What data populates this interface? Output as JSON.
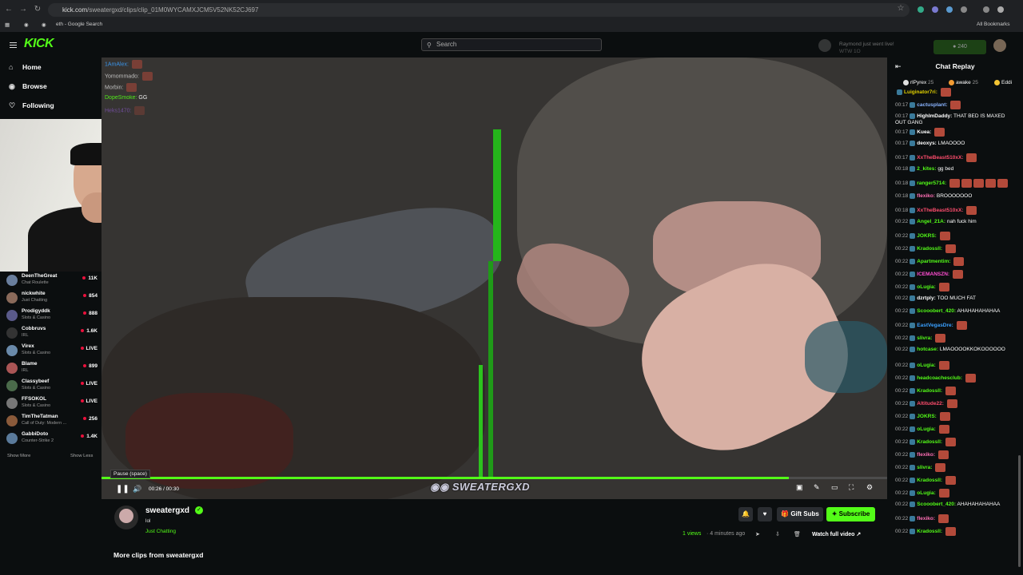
{
  "browser": {
    "url_host": "kick.com",
    "url_path": "/sweatergxd/clips/clip_01M0WYCAMXJCM5V52NK52CJ697",
    "bookmarks": [
      "eth - Google Search"
    ],
    "all_bookmarks": "All Bookmarks"
  },
  "header": {
    "logo": "KICK",
    "search_placeholder": "Search",
    "notification_title": "Raymond just went live!",
    "notification_sub": "WTW 1O",
    "coins": "240"
  },
  "sidebar": {
    "nav": [
      {
        "label": "Home",
        "icon": "home-icon"
      },
      {
        "label": "Browse",
        "icon": "browse-icon"
      },
      {
        "label": "Following",
        "icon": "heart-icon"
      }
    ],
    "channels": [
      {
        "name": "DeenTheGreat",
        "category": "Chat Roulette",
        "viewers": "11K",
        "color": "#6a7f9e"
      },
      {
        "name": "nickwhite",
        "category": "Just Chatting",
        "viewers": "854",
        "color": "#8a6a5a"
      },
      {
        "name": "Prodigyddk",
        "category": "Slots & Casino",
        "viewers": "888",
        "color": "#5a5a8a"
      },
      {
        "name": "Cobbruvs",
        "category": "IRL",
        "viewers": "1.6K",
        "color": "#333333"
      },
      {
        "name": "Virex",
        "category": "Slots & Casino",
        "viewers": "LIVE",
        "color": "#6a8aaa"
      },
      {
        "name": "Blame",
        "category": "IRL",
        "viewers": "899",
        "color": "#aa5555"
      },
      {
        "name": "Classybeef",
        "category": "Slots & Casino",
        "viewers": "LIVE",
        "color": "#4a6a4a"
      },
      {
        "name": "FFSOKOL",
        "category": "Slots & Casino",
        "viewers": "LIVE",
        "color": "#777777"
      },
      {
        "name": "TimTheTatman",
        "category": "Call of Duty: Modern ...",
        "viewers": "256",
        "color": "#8a5a3a"
      },
      {
        "name": "GabbiDoto",
        "category": "Counter-Strike 2",
        "viewers": "1.4K",
        "color": "#5a7a9a"
      }
    ],
    "show_more": "Show More",
    "show_less": "Show Less"
  },
  "stream_chat_overlay": [
    {
      "user": "1AmAlex:",
      "text": "",
      "color": "#3aa0ff"
    },
    {
      "user": "Yomommado:",
      "text": "",
      "color": "#cccccc"
    },
    {
      "user": "Morbin:",
      "text": "",
      "color": "#cccccc"
    },
    {
      "user": "DopeSmoke:",
      "text": "GG",
      "color": "#53fc18"
    },
    {
      "user": "Heks1470:",
      "text": "",
      "color": "#aa66ff"
    }
  ],
  "player": {
    "tooltip": "Pause (space)",
    "time": "00:26 / 00:30",
    "progress": 0.875,
    "watermark": "SWEATERGXD"
  },
  "clip": {
    "channel": "sweatergxd",
    "title": "lol",
    "category": "Just Chatting",
    "views": "1 views",
    "age": "4 minutes ago",
    "gift_subs": "Gift Subs",
    "subscribe": "Subscribe",
    "watch_full": "Watch full video",
    "more_clips": "More clips from sweatergxd"
  },
  "chat": {
    "title": "Chat Replay",
    "pinned": [
      {
        "name": "rlPyrex",
        "count": "25"
      },
      {
        "name": "awake",
        "count": "25"
      },
      {
        "name": "Eddi",
        "count": ""
      }
    ],
    "messages": [
      {
        "t": "",
        "u": "Luiginator7ri:",
        "c": "#e0d000",
        "m": "",
        "e": 1
      },
      {
        "t": "00:17",
        "u": "cactusplant:",
        "c": "#8ab4ff",
        "m": "",
        "e": 1
      },
      {
        "t": "00:17",
        "u": "HighImDaddy:",
        "c": "#ffffff",
        "m": "THAT BED IS MAXED OUT GANG",
        "e": 0
      },
      {
        "t": "00:17",
        "u": "Kuea:",
        "c": "#ffffff",
        "m": "",
        "e": 1
      },
      {
        "t": "00:17",
        "u": "deoxys:",
        "c": "#ffffff",
        "m": "LMAOOOO",
        "e": 0
      },
      {
        "t": "00:17",
        "u": "XxTheBeast510xX:",
        "c": "#ff4d6d",
        "m": "",
        "e": 1
      },
      {
        "t": "00:18",
        "u": "2_kites:",
        "c": "#53fc18",
        "m": "gg bed",
        "e": 0
      },
      {
        "t": "00:18",
        "u": "ranger5714:",
        "c": "#53fc18",
        "m": "",
        "e": 5
      },
      {
        "t": "00:18",
        "u": "flexiko:",
        "c": "#ff6fb5",
        "m": "BROOOOOOO",
        "e": 0
      },
      {
        "t": "00:18",
        "u": "XxTheBeast510xX:",
        "c": "#ff4d6d",
        "m": "",
        "e": 1
      },
      {
        "t": "00:22",
        "u": "Angel_21A:",
        "c": "#53fc18",
        "m": "nah fuck him",
        "e": 0
      },
      {
        "t": "00:22",
        "u": "JOKRS:",
        "c": "#53fc18",
        "m": "",
        "e": 1
      },
      {
        "t": "00:22",
        "u": "Kradossll:",
        "c": "#53fc18",
        "m": "",
        "e": 1
      },
      {
        "t": "00:22",
        "u": "Apartmentim:",
        "c": "#53fc18",
        "m": "",
        "e": 1
      },
      {
        "t": "00:22",
        "u": "ICEMANSZN:",
        "c": "#ff4dd2",
        "m": "",
        "e": 1
      },
      {
        "t": "00:22",
        "u": "oLugia:",
        "c": "#53fc18",
        "m": "",
        "e": 1
      },
      {
        "t": "00:22",
        "u": "dzrtply:",
        "c": "#ffffff",
        "m": "TOO MUCH FAT",
        "e": 0
      },
      {
        "t": "00:22",
        "u": "Scooobert_420:",
        "c": "#53fc18",
        "m": "AHAHAHAHAHAA",
        "e": 0
      },
      {
        "t": "00:22",
        "u": "EastVegasDre:",
        "c": "#3aa0ff",
        "m": "",
        "e": 1
      },
      {
        "t": "00:22",
        "u": "slivra:",
        "c": "#53fc18",
        "m": "",
        "e": 1
      },
      {
        "t": "00:22",
        "u": "hotcase:",
        "c": "#53fc18",
        "m": "LMAOOOOKKOKOOOOOO",
        "e": 0
      },
      {
        "t": "00:22",
        "u": "oLugia:",
        "c": "#53fc18",
        "m": "",
        "e": 1
      },
      {
        "t": "00:22",
        "u": "headcoachesclub:",
        "c": "#53fc18",
        "m": "",
        "e": 1
      },
      {
        "t": "00:22",
        "u": "Kradossll:",
        "c": "#53fc18",
        "m": "",
        "e": 1
      },
      {
        "t": "00:22",
        "u": "Altitude22:",
        "c": "#ff4d6d",
        "m": "",
        "e": 1
      },
      {
        "t": "00:22",
        "u": "JOKRS:",
        "c": "#53fc18",
        "m": "",
        "e": 1
      },
      {
        "t": "00:22",
        "u": "oLugia:",
        "c": "#53fc18",
        "m": "",
        "e": 1
      },
      {
        "t": "00:22",
        "u": "Kradossll:",
        "c": "#53fc18",
        "m": "",
        "e": 1
      },
      {
        "t": "00:22",
        "u": "flexiko:",
        "c": "#ff6fb5",
        "m": "",
        "e": 1
      },
      {
        "t": "00:22",
        "u": "slivra:",
        "c": "#53fc18",
        "m": "",
        "e": 1
      },
      {
        "t": "00:22",
        "u": "Kradossll:",
        "c": "#53fc18",
        "m": "",
        "e": 1
      },
      {
        "t": "00:22",
        "u": "oLugia:",
        "c": "#53fc18",
        "m": "",
        "e": 1
      },
      {
        "t": "00:22",
        "u": "Scooobert_420:",
        "c": "#53fc18",
        "m": "AHAHAHAHAHAA",
        "e": 0
      },
      {
        "t": "00:22",
        "u": "flexiko:",
        "c": "#ff6fb5",
        "m": "",
        "e": 1
      },
      {
        "t": "00:22",
        "u": "Kradossll:",
        "c": "#53fc18",
        "m": "",
        "e": 1
      }
    ]
  },
  "colors": {
    "accent": "#53fc18",
    "bg": "#0b0e0f"
  }
}
